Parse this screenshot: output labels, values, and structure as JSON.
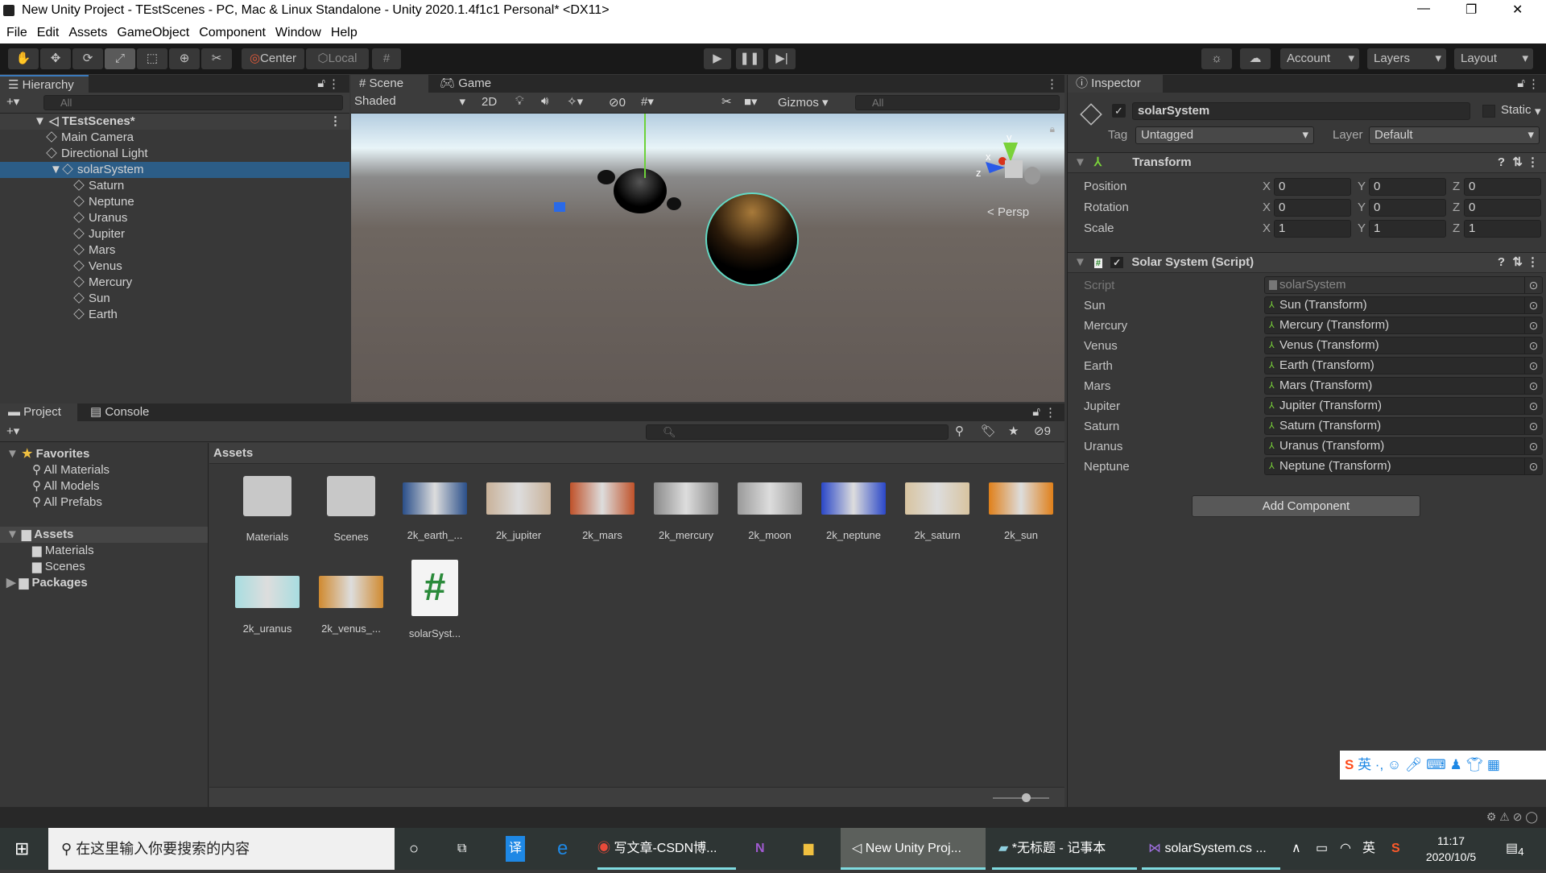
{
  "window": {
    "title": "New Unity Project - TEstScenes - PC, Mac & Linux Standalone - Unity 2020.1.4f1c1 Personal* <DX11>"
  },
  "menu": [
    "File",
    "Edit",
    "Assets",
    "GameObject",
    "Component",
    "Window",
    "Help"
  ],
  "toolbar": {
    "pivot": "Center",
    "space": "Local",
    "account": "Account",
    "layers": "Layers",
    "layout": "Layout"
  },
  "hierarchy": {
    "tab": "Hierarchy",
    "search_placeholder": "All",
    "scene": "TEstScenes*",
    "items": [
      {
        "label": "Main Camera",
        "depth": 1
      },
      {
        "label": "Directional Light",
        "depth": 1
      },
      {
        "label": "solarSystem",
        "depth": 1,
        "selected": true
      },
      {
        "label": "Saturn",
        "depth": 2
      },
      {
        "label": "Neptune",
        "depth": 2
      },
      {
        "label": "Uranus",
        "depth": 2
      },
      {
        "label": "Jupiter",
        "depth": 2
      },
      {
        "label": "Mars",
        "depth": 2
      },
      {
        "label": "Venus",
        "depth": 2
      },
      {
        "label": "Mercury",
        "depth": 2
      },
      {
        "label": "Sun",
        "depth": 2
      },
      {
        "label": "Earth",
        "depth": 2
      }
    ]
  },
  "scene": {
    "tabs": [
      "Scene",
      "Game"
    ],
    "shading": "Shaded",
    "mode_2d": "2D",
    "hidden_count": "0",
    "gizmos": "Gizmos",
    "search_placeholder": "All",
    "projection": "Persp",
    "axes": {
      "x": "x",
      "y": "y",
      "z": "z"
    }
  },
  "inspector": {
    "tab": "Inspector",
    "object_name": "solarSystem",
    "static_label": "Static",
    "tag_label": "Tag",
    "tag": "Untagged",
    "layer_label": "Layer",
    "layer": "Default",
    "transform": {
      "title": "Transform",
      "rows": [
        {
          "label": "Position",
          "x": "0",
          "y": "0",
          "z": "0"
        },
        {
          "label": "Rotation",
          "x": "0",
          "y": "0",
          "z": "0"
        },
        {
          "label": "Scale",
          "x": "1",
          "y": "1",
          "z": "1"
        }
      ]
    },
    "script": {
      "title": "Solar System (Script)",
      "script_label": "Script",
      "script_value": "solarSystem",
      "fields": [
        {
          "label": "Sun",
          "value": "Sun (Transform)"
        },
        {
          "label": "Mercury",
          "value": "Mercury (Transform)"
        },
        {
          "label": "Venus",
          "value": "Venus (Transform)"
        },
        {
          "label": "Earth",
          "value": "Earth (Transform)"
        },
        {
          "label": "Mars",
          "value": "Mars (Transform)"
        },
        {
          "label": "Jupiter",
          "value": "Jupiter (Transform)"
        },
        {
          "label": "Saturn",
          "value": "Saturn (Transform)"
        },
        {
          "label": "Uranus",
          "value": "Uranus (Transform)"
        },
        {
          "label": "Neptune",
          "value": "Neptune (Transform)"
        }
      ]
    },
    "add_component": "Add Component"
  },
  "project": {
    "tabs": [
      "Project",
      "Console"
    ],
    "hidden_count": "9",
    "breadcrumb": "Assets",
    "tree": [
      {
        "label": "Favorites",
        "bold": true
      },
      {
        "label": "All Materials"
      },
      {
        "label": "All Models"
      },
      {
        "label": "All Prefabs"
      },
      {
        "label": "Assets",
        "bold": true
      },
      {
        "label": "Materials"
      },
      {
        "label": "Scenes"
      },
      {
        "label": "Packages",
        "bold": true
      }
    ],
    "assets": [
      {
        "label": "Materials",
        "kind": "folder"
      },
      {
        "label": "Scenes",
        "kind": "folder"
      },
      {
        "label": "2k_earth_...",
        "color": "#2a4f8a"
      },
      {
        "label": "2k_jupiter",
        "color": "#c9b29a"
      },
      {
        "label": "2k_mars",
        "color": "#c0522a"
      },
      {
        "label": "2k_mercury",
        "color": "#8a8a8a"
      },
      {
        "label": "2k_moon",
        "color": "#9a9a9a"
      },
      {
        "label": "2k_neptune",
        "color": "#2a47c8"
      },
      {
        "label": "2k_saturn",
        "color": "#d8c4a0"
      },
      {
        "label": "2k_sun",
        "color": "#e0801a"
      },
      {
        "label": "2k_uranus",
        "color": "#a8dde0"
      },
      {
        "label": "2k_venus_...",
        "color": "#d08a30"
      },
      {
        "label": "solarSyst...",
        "kind": "script"
      }
    ]
  },
  "taskbar": {
    "search_placeholder": "在这里输入你要搜索的内容",
    "apps": [
      "写文章-CSDN博...",
      "New Unity Proj...",
      "*无标题 - 记事本",
      "solarSystem.cs ..."
    ],
    "ime": "英",
    "time": "11:17",
    "date": "2020/10/5",
    "notifications": "4"
  }
}
